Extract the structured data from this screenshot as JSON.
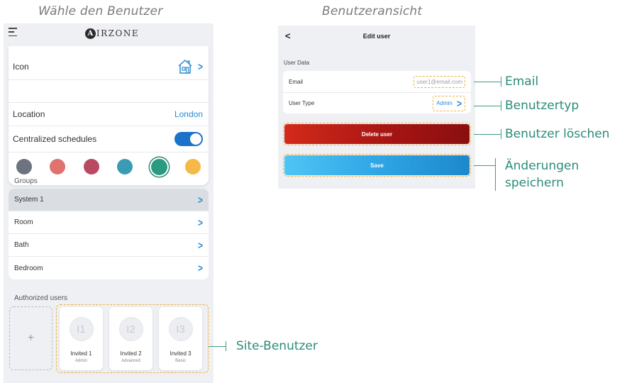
{
  "captions": {
    "left": "Wähle den Benutzer",
    "right": "Benutzeransicht"
  },
  "left_screen": {
    "topbar": {
      "menu_icon": "hamburger-menu-icon",
      "logo_letter": "A",
      "logo_text": "IRZONE"
    },
    "settings": {
      "icon_label": "Icon",
      "icon_value": "house-icon",
      "location_label": "Location",
      "location_value": "London",
      "schedules_label": "Centralized schedules",
      "schedules_enabled": true,
      "colors": [
        "#6d7480",
        "#e0736e",
        "#b84960",
        "#3a9bb5",
        "#2b9a82",
        "#f5b945"
      ],
      "selected_color_index": 4
    },
    "groups": {
      "title": "Groups",
      "items": [
        {
          "label": "System 1",
          "active": true
        },
        {
          "label": "Room",
          "active": false
        },
        {
          "label": "Bath",
          "active": false
        },
        {
          "label": "Bedroom",
          "active": false
        }
      ]
    },
    "authorized_users": {
      "title": "Authorized users",
      "add_label": "+",
      "users": [
        {
          "initials": "I1",
          "name": "Invited 1",
          "role": "Admin"
        },
        {
          "initials": "I2",
          "name": "Invited 2",
          "role": "Advanced"
        },
        {
          "initials": "I3",
          "name": "Invited 3",
          "role": "Basic"
        }
      ]
    }
  },
  "right_screen": {
    "back_icon": "back-arrow-icon",
    "title": "Edit user",
    "section_label": "User Data",
    "email_label": "Email",
    "email_value": "user1@email.com",
    "type_label": "User Type",
    "type_value": "Admin",
    "delete_label": "Delete user",
    "save_label": "Save"
  },
  "callouts": {
    "email": "Email",
    "user_type": "Benutzertyp",
    "delete": "Benutzer löschen",
    "save_line1": "Änderungen",
    "save_line2": "speichern",
    "site_users": "Site-Benutzer"
  },
  "colors": {
    "accent_blue": "#2a8bd0",
    "toggle_blue": "#1a73c9",
    "highlight_frame": "#f2b13c",
    "callout_teal": "#2a8c7a",
    "delete_red": "#b3161a",
    "save_blue": "#2fa6e6"
  }
}
